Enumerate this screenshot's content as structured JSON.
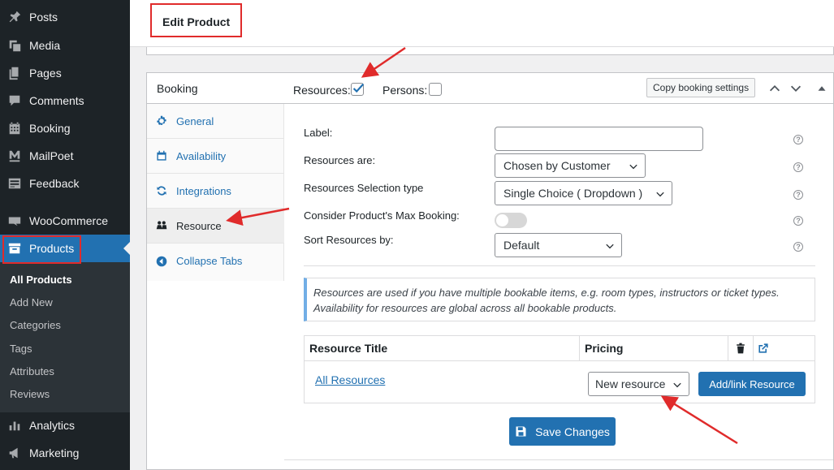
{
  "sidebar": {
    "items": [
      {
        "label": "Posts",
        "icon": "pin-icon"
      },
      {
        "label": "Media",
        "icon": "media-icon"
      },
      {
        "label": "Pages",
        "icon": "pages-icon"
      },
      {
        "label": "Comments",
        "icon": "comments-icon"
      },
      {
        "label": "Booking",
        "icon": "calendar-icon"
      },
      {
        "label": "MailPoet",
        "icon": "mailpoet-icon"
      },
      {
        "label": "Feedback",
        "icon": "feedback-icon"
      },
      {
        "label": "WooCommerce",
        "icon": "woocommerce-icon"
      },
      {
        "label": "Products",
        "icon": "archive-icon",
        "active": true
      },
      {
        "label": "Analytics",
        "icon": "bar-chart-icon"
      },
      {
        "label": "Marketing",
        "icon": "megaphone-icon"
      }
    ],
    "submenu": [
      "All Products",
      "Add New",
      "Categories",
      "Tags",
      "Attributes",
      "Reviews"
    ],
    "active_color": "#2271b1"
  },
  "header": {
    "title": "Edit Product"
  },
  "booking": {
    "title": "Booking",
    "resources_label": "Resources:",
    "resources_checked": true,
    "persons_label": "Persons:",
    "persons_checked": false,
    "copy_button": "Copy booking settings",
    "tabs": [
      {
        "label": "General",
        "icon": "gear-icon"
      },
      {
        "label": "Availability",
        "icon": "calendar-icon"
      },
      {
        "label": "Integrations",
        "icon": "sync-icon"
      },
      {
        "label": "Resource",
        "icon": "people-icon",
        "active": true
      },
      {
        "label": "Collapse Tabs",
        "icon": "collapse-icon"
      }
    ],
    "fields": {
      "label": {
        "label": "Label:",
        "value": ""
      },
      "resources_are": {
        "label": "Resources are:",
        "value": "Chosen by Customer"
      },
      "selection_type": {
        "label": "Resources Selection type",
        "value": "Single Choice ( Dropdown )"
      },
      "max_booking": {
        "label": "Consider Product's Max Booking:",
        "enabled": false
      },
      "sort_by": {
        "label": "Sort Resources by:",
        "value": "Default"
      }
    },
    "notice": "Resources are used if you have multiple bookable items, e.g. room types, instructors or ticket types. Availability for resources are global across all bookable products.",
    "table": {
      "col_title": "Resource Title",
      "col_pricing": "Pricing",
      "link": "All Resources",
      "select_value": "New resource",
      "add_button": "Add/link Resource"
    },
    "save_button": "Save Changes"
  },
  "annotation_color": "#e02b2b"
}
